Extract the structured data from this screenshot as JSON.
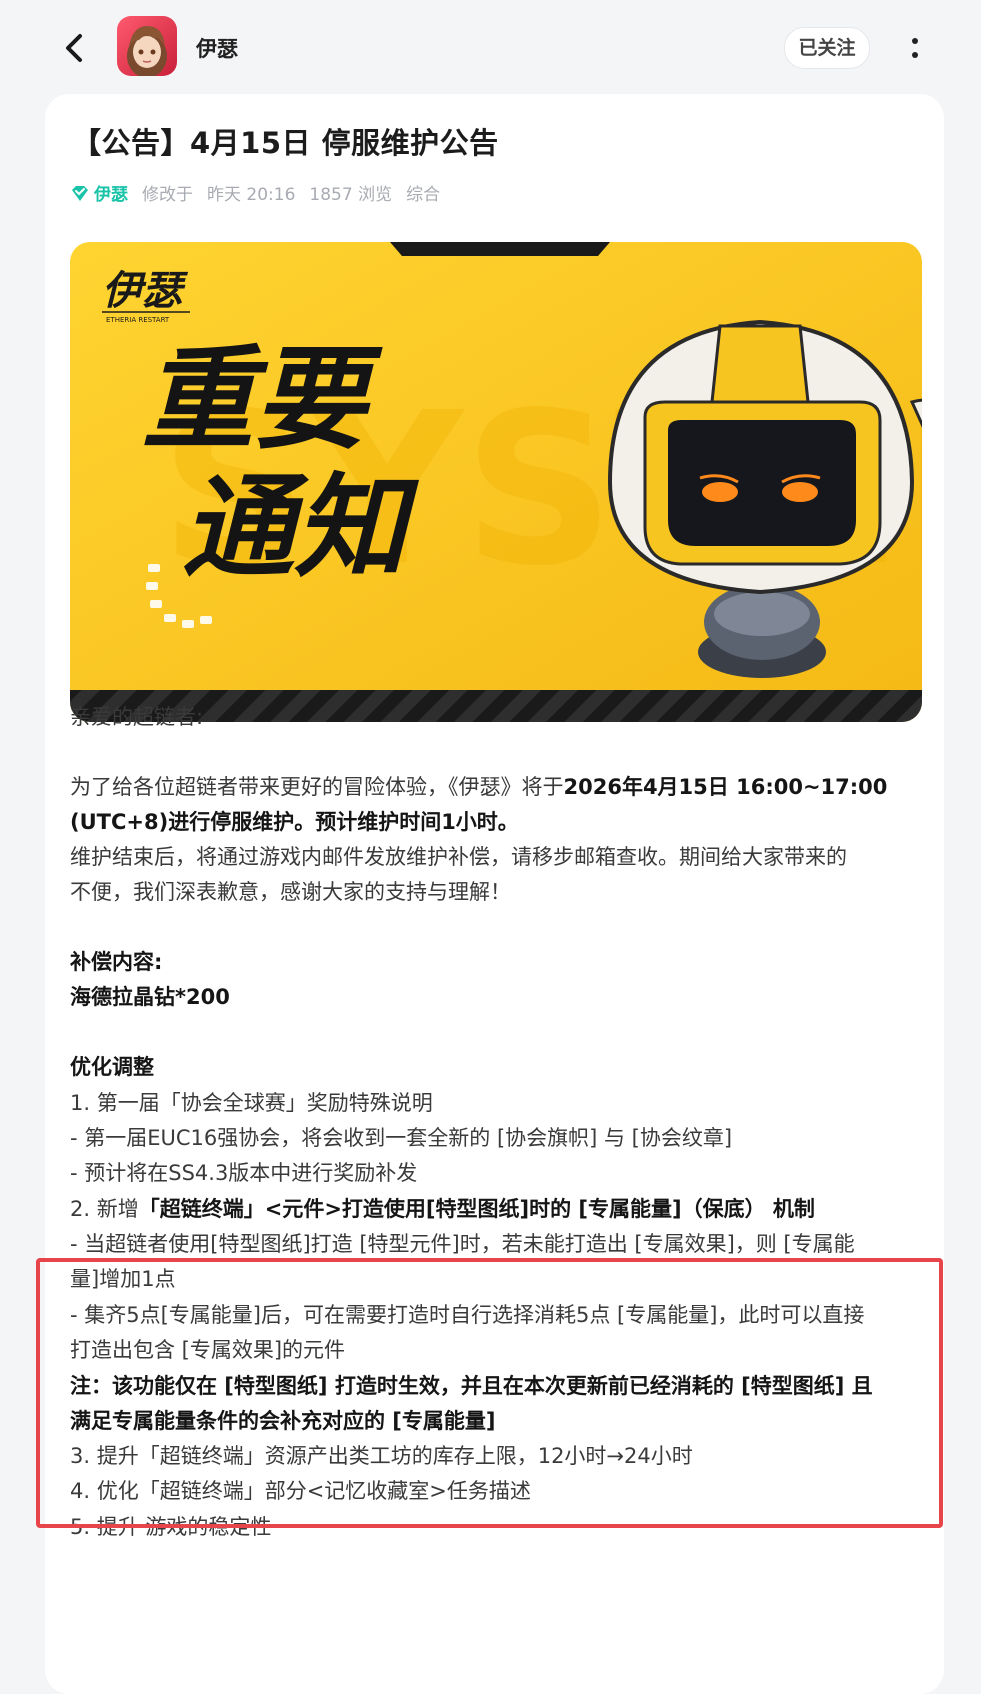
{
  "header": {
    "back_icon": "chevron-left-icon",
    "app_name": "伊瑟",
    "follow_label": "已关注",
    "more_icon": "vertical-dots-icon"
  },
  "post": {
    "title": "【公告】4月15日 停服维护公告",
    "author": "伊瑟",
    "edited_label": "修改于",
    "time": "昨天 20:16",
    "views": "1857 浏览",
    "category": "综合",
    "verified_icon": "diamond-verified-icon",
    "accent_color": "#19c3a8"
  },
  "banner": {
    "logo_text": "伊瑟",
    "logo_sub": "ETHERIA RESTART",
    "headline_top": "重要",
    "headline_bottom": "通知",
    "background_color": "#f7c520"
  },
  "body": {
    "greeting": "亲爱的超链者:",
    "p1_a": "为了给各位超链者带来更好的冒险体验，《伊瑟》将于",
    "p1_b": "2026年4月15日 16:00~17:00",
    "p1_c": "(UTC+8)进行停服维护。预计维护时间1小时。",
    "p2_a": "维护结束后，将通过游戏内邮件发放维护补偿，请移步邮箱查收。期间给大家带来的",
    "p2_b": "不便，我们深表歉意，感谢大家的支持与理解！",
    "comp_title": "补偿内容:",
    "comp_item": "海德拉晶钻*200",
    "opt_title": "优化调整",
    "l1": "1. 第一届「协会全球赛」奖励特殊说明",
    "l1_a": "- 第一届EUC16强协会，将会收到一套全新的 [协会旗帜] 与 [协会纹章]",
    "l1_b": "- 预计将在SS4.3版本中进行奖励补发",
    "l2_prefix": "2. 新增",
    "l2_bold": "「超链终端」<元件>打造使用[特型图纸]时的 [专属能量]（保底） 机制",
    "l2_a1": "- 当超链者使用[特型图纸]打造 [特型元件]时，若未能打造出 [专属效果]，则 [专属能",
    "l2_a2": "量]增加1点",
    "l2_b1": "- 集齐5点[专属能量]后，可在需要打造时自行选择消耗5点 [专属能量]，此时可以直接",
    "l2_b2": "打造出包含 [专属效果]的元件",
    "l2_note1": "注：该功能仅在 [特型图纸] 打造时生效，并且在本次更新前已经消耗的 [特型图纸] 且",
    "l2_note2": "满足专属能量条件的会补充对应的 [专属能量]",
    "l3": "3. 提升「超链终端」资源产出类工坊的库存上限，12小时→24小时",
    "l4": "4. 优化「超链终端」部分<记忆收藏室>任务描述",
    "l5": "5. 提升 游戏的稳定性"
  },
  "highlight_color": "#e8454a"
}
